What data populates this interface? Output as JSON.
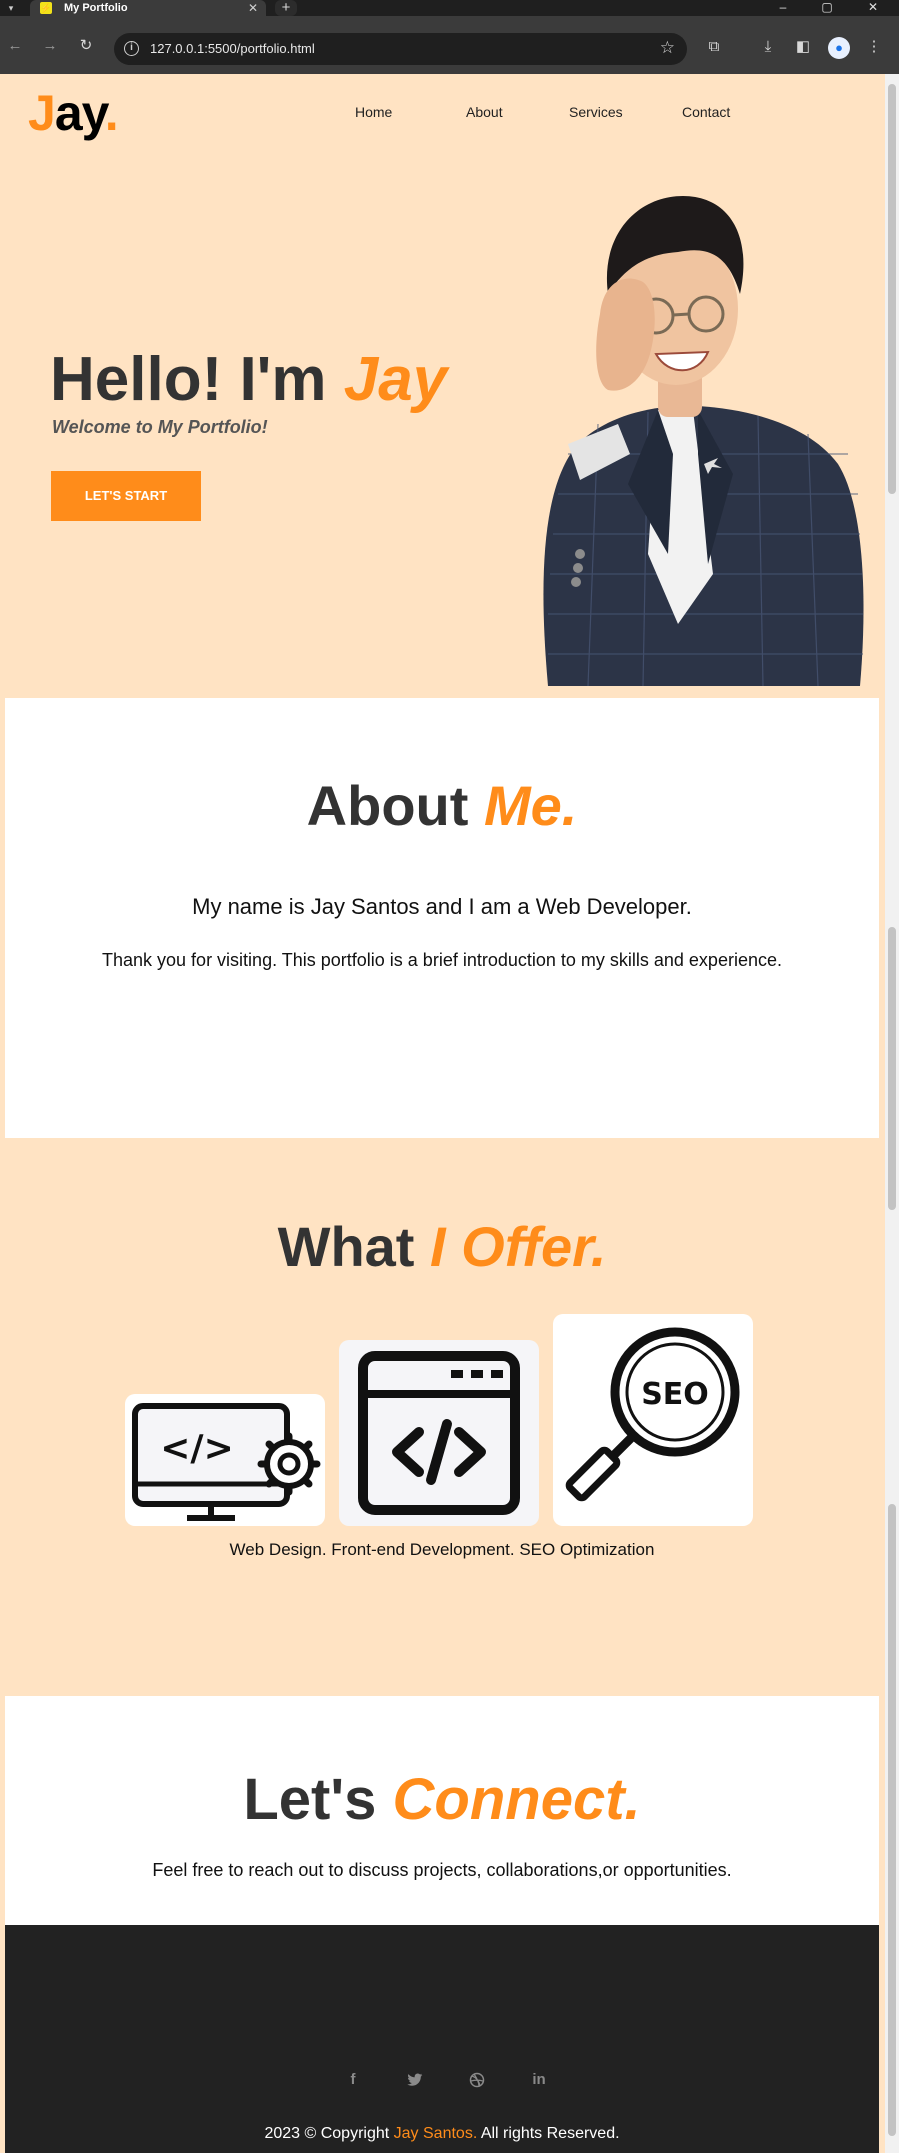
{
  "browser": {
    "tab_title": "My Portfolio",
    "url": "127.0.0.1:5500/portfolio.html"
  },
  "header": {
    "logo_j": "J",
    "logo_rest": "ay",
    "logo_dot": ".",
    "nav": [
      "Home",
      "About",
      "Services",
      "Contact"
    ]
  },
  "hero": {
    "title_prefix": "Hello! I'm",
    "title_name": "Jay",
    "subtitle": "Welcome to My Portfolio!",
    "cta": "LET'S START"
  },
  "about": {
    "title_prefix": "About",
    "title_accent": "Me.",
    "line1": "My name is Jay Santos and I am a Web Developer.",
    "line2": "Thank you for visiting. This portfolio is a brief introduction to my skills and experience."
  },
  "services": {
    "title_prefix": "What",
    "title_accent": "I Offer.",
    "icons": [
      "web-design-icon",
      "code-window-icon",
      "seo-icon"
    ],
    "seo_text": "SEO",
    "caption": "Web Design. Front-end Development. SEO Optimization"
  },
  "connect": {
    "title_prefix": "Let's",
    "title_accent": "Connect.",
    "text": "Feel free to reach out to discuss projects, collaborations,or opportunities."
  },
  "footer": {
    "social": [
      "facebook-icon",
      "twitter-icon",
      "dribbble-icon",
      "linkedin-icon"
    ],
    "copyright_prefix": "2023 © Copyright",
    "copyright_name": "Jay Santos.",
    "copyright_suffix": "All rights Reserved."
  },
  "colors": {
    "accent": "#ff8c1a",
    "background": "#ffe3c3",
    "heading": "#333333",
    "footer": "#222222"
  }
}
